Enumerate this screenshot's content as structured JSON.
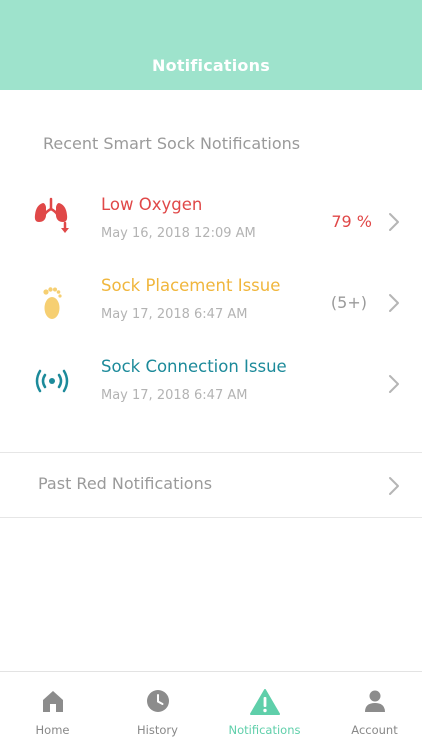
{
  "header": {
    "title": "Notifications"
  },
  "recent": {
    "title": "Recent Smart Sock Notifications",
    "items": [
      {
        "title": "Low Oxygen",
        "date": "May 16, 2018  12:09 AM",
        "value": "79 %",
        "color": "#e04848",
        "icon": "lungs-icon"
      },
      {
        "title": "Sock Placement Issue",
        "date": "May 17, 2018  6:47 AM",
        "value": "(5+)",
        "color": "#f0b63c",
        "icon": "foot-icon"
      },
      {
        "title": "Sock Connection Issue",
        "date": "May 17, 2018  6:47 AM",
        "value": "",
        "color": "#1c8a9a",
        "icon": "signal-icon"
      }
    ]
  },
  "past": {
    "label": "Past Red Notifications"
  },
  "tabs": [
    {
      "label": "Home",
      "icon": "home-icon"
    },
    {
      "label": "History",
      "icon": "clock-icon"
    },
    {
      "label": "Notifications",
      "icon": "warning-icon",
      "active": true
    },
    {
      "label": "Account",
      "icon": "user-icon"
    }
  ],
  "colors": {
    "accent": "#9ee3cc",
    "active_tab": "#5fcfaa"
  }
}
